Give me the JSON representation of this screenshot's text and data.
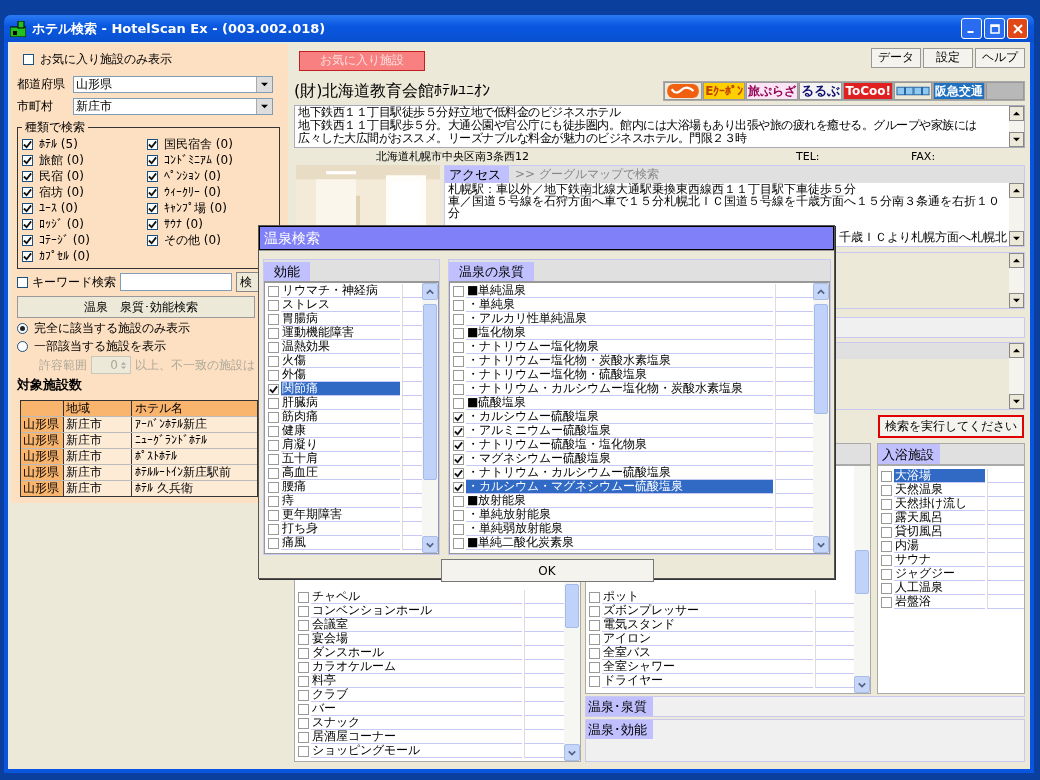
{
  "window": {
    "title": "ホテル検索 - HotelScan Ex - (003.002.018)"
  },
  "filters": {
    "favorites_only": {
      "label": "お気に入り施設のみ表示",
      "checked": false
    },
    "prefecture": {
      "label": "都道府県",
      "value": "山形県"
    },
    "city": {
      "label": "市町村",
      "value": "新庄市"
    },
    "type_search": {
      "title": "種類で検索",
      "columns": [
        [
          {
            "label": "ﾎﾃﾙ (5)",
            "checked": true
          },
          {
            "label": "旅館 (0)",
            "checked": true
          },
          {
            "label": "民宿 (0)",
            "checked": true
          },
          {
            "label": "宿坊 (0)",
            "checked": true
          },
          {
            "label": "ﾕｰｽ (0)",
            "checked": true
          },
          {
            "label": "ﾛｯｼﾞ (0)",
            "checked": true
          },
          {
            "label": "ｺﾃｰｼﾞ (0)",
            "checked": true
          },
          {
            "label": "ｶﾌﾟｾﾙ (0)",
            "checked": true
          }
        ],
        [
          {
            "label": "国民宿舎 (0)",
            "checked": true
          },
          {
            "label": "ｺﾝﾄﾞﾐﾆｱﾑ (0)",
            "checked": true
          },
          {
            "label": "ﾍﾟﾝｼｮﾝ (0)",
            "checked": true
          },
          {
            "label": "ｳｨｰｸﾘｰ (0)",
            "checked": true
          },
          {
            "label": "ｷｬﾝﾌﾟ場 (0)",
            "checked": true
          },
          {
            "label": "ｻｳﾅ (0)",
            "checked": true
          },
          {
            "label": "その他 (0)",
            "checked": true
          }
        ]
      ]
    },
    "keyword": {
      "label": "キーワード検索",
      "checked": false,
      "button": "検"
    },
    "onsen_button": "温泉　泉質･効能検索",
    "match_modes": [
      {
        "label": "完全に該当する施設のみ表示",
        "selected": true
      },
      {
        "label": "一部該当する施設を表示",
        "selected": false
      }
    ],
    "tolerance": {
      "label": "許容範囲",
      "value": "0",
      "suffix": "以上、不一致の施設は",
      "disabled": true
    }
  },
  "results": {
    "title": "対象施設数",
    "columns": [
      "地域",
      "ホテル名"
    ],
    "rows": [
      {
        "prefecture": "山形県",
        "area": "新庄市",
        "name": "ｱｰﾊﾞﾝﾎﾃﾙ新庄"
      },
      {
        "prefecture": "山形県",
        "area": "新庄市",
        "name": "ﾆｭｰｸﾞﾗﾝﾄﾞﾎﾃﾙ"
      },
      {
        "prefecture": "山形県",
        "area": "新庄市",
        "name": "ﾎﾟｽﾄﾎﾃﾙ"
      },
      {
        "prefecture": "山形県",
        "area": "新庄市",
        "name": "ﾎﾃﾙﾙｰﾄｲﾝ新庄駅前"
      },
      {
        "prefecture": "山形県",
        "area": "新庄市",
        "name": "ﾎﾃﾙ 久兵衛"
      }
    ]
  },
  "toolbar": {
    "favorites_button": "お気に入り施設",
    "buttons": [
      "データ",
      "設定",
      "ヘルプ"
    ]
  },
  "hotel": {
    "name": "(財)北海道教育会館ﾎﾃﾙﾕﾆｵﾝ",
    "sites": [
      {
        "kind": "swoosh"
      },
      {
        "kind": "text",
        "label": "Eｸｰﾎﾟﾝ"
      },
      {
        "kind": "text",
        "label": "旅ぷらざ"
      },
      {
        "kind": "text",
        "label": "るるぶ"
      },
      {
        "kind": "text",
        "label": "ToCoo!"
      },
      {
        "kind": "blocks"
      },
      {
        "kind": "text",
        "label": "阪急交通"
      },
      {
        "kind": "blank"
      }
    ],
    "description": [
      "地下鉄西１１丁目駅徒歩５分好立地で低料金のビジネスホテル",
      "地下鉄西１１丁目駅歩５分。大通公園や官公庁にも徒歩圏内。館内には大浴場もあり出張や旅の疲れを癒せる。グループや家族には",
      "広々した大広間がおススメ。リーズナブルな料金が魅力のビジネスホテル。門限２３時"
    ],
    "address": "北海道札幌市中央区南3条西12",
    "tel_label": "TEL:",
    "fax_label": "FAX:",
    "access": {
      "tab": "アクセス",
      "link": ">> グーグルマップで検索",
      "lines": [
        "札幌駅：車以外／地下鉄南北線大通駅乗換東西線西１１丁目駅下車徒歩５分",
        "車／国道５号線を石狩方面へ車で１５分札幌北ＩＣ国道５号線を千歳方面へ１５分南３条通を右折１０",
        "分"
      ],
      "tail": "千歳ＩＣより札幌方面へ札幌北"
    }
  },
  "search_button": "検索を実行してください",
  "facilities": {
    "items": [
      {
        "label": "チャペル",
        "checked": false
      },
      {
        "label": "コンベンションホール",
        "checked": false
      },
      {
        "label": "会議室",
        "checked": false
      },
      {
        "label": "宴会場",
        "checked": false
      },
      {
        "label": "ダンスホール",
        "checked": false
      },
      {
        "label": "カラオケルーム",
        "checked": false
      },
      {
        "label": "料亭",
        "checked": false
      },
      {
        "label": "クラブ",
        "checked": false
      },
      {
        "label": "バー",
        "checked": false
      },
      {
        "label": "スナック",
        "checked": false
      },
      {
        "label": "居酒屋コーナー",
        "checked": false
      },
      {
        "label": "ショッピングモール",
        "checked": false
      }
    ]
  },
  "room_amenities": {
    "items": [
      {
        "label": "ポット",
        "checked": false
      },
      {
        "label": "ズボンプレッサー",
        "checked": false
      },
      {
        "label": "電気スタンド",
        "checked": false
      },
      {
        "label": "アイロン",
        "checked": false
      },
      {
        "label": "全室バス",
        "checked": false
      },
      {
        "label": "全室シャワー",
        "checked": false
      },
      {
        "label": "ドライヤー",
        "checked": false
      }
    ]
  },
  "bath": {
    "title": "入浴施設",
    "items": [
      {
        "label": "大浴場",
        "checked": false,
        "selected": true
      },
      {
        "label": "天然温泉",
        "checked": false,
        "selected": false
      },
      {
        "label": "天然掛け流し",
        "checked": false,
        "selected": false
      },
      {
        "label": "露天風呂",
        "checked": false,
        "selected": false
      },
      {
        "label": "貸切風呂",
        "checked": false,
        "selected": false
      },
      {
        "label": "内湯",
        "checked": false,
        "selected": false
      },
      {
        "label": "サウナ",
        "checked": false,
        "selected": false
      },
      {
        "label": "ジャグジー",
        "checked": false,
        "selected": false
      },
      {
        "label": "人工温泉",
        "checked": false,
        "selected": false
      },
      {
        "label": "岩盤浴",
        "checked": false,
        "selected": false
      }
    ]
  },
  "onsen_quality": {
    "label": "温泉･泉質"
  },
  "onsen_effect": {
    "label": "温泉･効能"
  },
  "dialog": {
    "title": "温泉検索",
    "effects": {
      "title": "効能",
      "items": [
        {
          "label": "リウマチ・神経病",
          "checked": false,
          "selected": false
        },
        {
          "label": "ストレス",
          "checked": false,
          "selected": false
        },
        {
          "label": "胃腸病",
          "checked": false,
          "selected": false
        },
        {
          "label": "運動機能障害",
          "checked": false,
          "selected": false
        },
        {
          "label": "温熱効果",
          "checked": false,
          "selected": false
        },
        {
          "label": "火傷",
          "checked": false,
          "selected": false
        },
        {
          "label": "外傷",
          "checked": false,
          "selected": false
        },
        {
          "label": "関節痛",
          "checked": true,
          "selected": true
        },
        {
          "label": "肝臓病",
          "checked": false,
          "selected": false
        },
        {
          "label": "筋肉痛",
          "checked": false,
          "selected": false
        },
        {
          "label": "健康",
          "checked": false,
          "selected": false
        },
        {
          "label": "肩凝り",
          "checked": false,
          "selected": false
        },
        {
          "label": "五十肩",
          "checked": false,
          "selected": false
        },
        {
          "label": "高血圧",
          "checked": false,
          "selected": false
        },
        {
          "label": "腰痛",
          "checked": false,
          "selected": false
        },
        {
          "label": "痔",
          "checked": false,
          "selected": false
        },
        {
          "label": "更年期障害",
          "checked": false,
          "selected": false
        },
        {
          "label": "打ち身",
          "checked": false,
          "selected": false
        },
        {
          "label": "痛風",
          "checked": false,
          "selected": false
        }
      ]
    },
    "qualities": {
      "title": "温泉の泉質",
      "items": [
        {
          "label": "■単純温泉",
          "checked": false,
          "selected": false
        },
        {
          "label": "・単純泉",
          "checked": false,
          "selected": false
        },
        {
          "label": "・アルカリ性単純温泉",
          "checked": false,
          "selected": false
        },
        {
          "label": "■塩化物泉",
          "checked": false,
          "selected": false
        },
        {
          "label": "・ナトリウムー塩化物泉",
          "checked": false,
          "selected": false
        },
        {
          "label": "・ナトリウムー塩化物・炭酸水素塩泉",
          "checked": false,
          "selected": false
        },
        {
          "label": "・ナトリウムー塩化物・硫酸塩泉",
          "checked": false,
          "selected": false
        },
        {
          "label": "・ナトリウム・カルシウムー塩化物・炭酸水素塩泉",
          "checked": false,
          "selected": false
        },
        {
          "label": "■硫酸塩泉",
          "checked": false,
          "selected": false
        },
        {
          "label": "・カルシウムー硫酸塩泉",
          "checked": true,
          "selected": false
        },
        {
          "label": "・アルミニウムー硫酸塩泉",
          "checked": true,
          "selected": false
        },
        {
          "label": "・ナトリウムー硫酸塩・塩化物泉",
          "checked": true,
          "selected": false
        },
        {
          "label": "・マグネシウムー硫酸塩泉",
          "checked": true,
          "selected": false
        },
        {
          "label": "・ナトリウム・カルシウムー硫酸塩泉",
          "checked": true,
          "selected": false
        },
        {
          "label": "・カルシウム・マグネシウムー硫酸塩泉",
          "checked": true,
          "selected": true
        },
        {
          "label": "■放射能泉",
          "checked": false,
          "selected": false
        },
        {
          "label": "・単純放射能泉",
          "checked": false,
          "selected": false
        },
        {
          "label": "・単純弱放射能泉",
          "checked": false,
          "selected": false
        },
        {
          "label": "■単純二酸化炭素泉",
          "checked": false,
          "selected": false
        }
      ]
    },
    "ok": "OK"
  }
}
